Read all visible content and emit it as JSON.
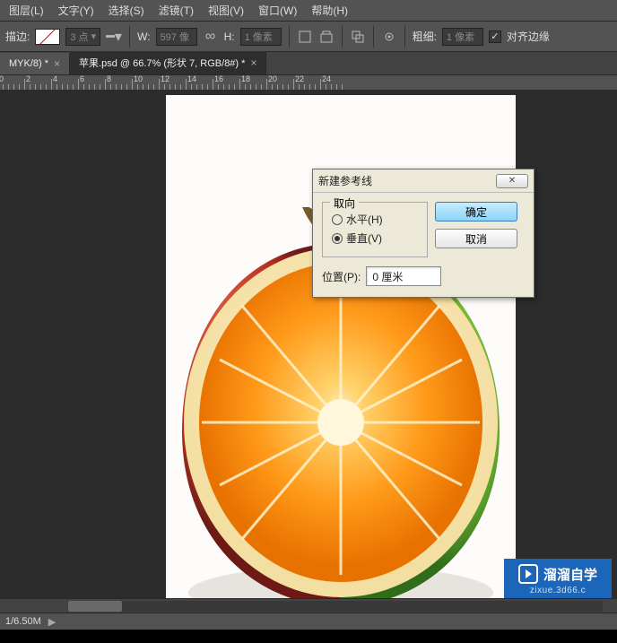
{
  "menu": {
    "items": [
      "图层(L)",
      "文字(Y)",
      "选择(S)",
      "滤镜(T)",
      "视图(V)",
      "窗口(W)",
      "帮助(H)"
    ]
  },
  "options": {
    "stroke_label": "描边:",
    "pt_value": "3 点",
    "w_label": "W:",
    "w_value": "597 像",
    "link_icon": "∞",
    "h_label": "H:",
    "h_value": "1 像素",
    "thickness_label": "粗细:",
    "thickness_value": "1 像素",
    "align_label": "对齐边缘"
  },
  "tabs": [
    {
      "label": "MYK/8) *",
      "active": false
    },
    {
      "label": "苹果.psd @ 66.7% (形状 7, RGB/8#) *",
      "active": true
    }
  ],
  "ruler_labels": [
    "0",
    "2",
    "4",
    "6",
    "8",
    "10",
    "12",
    "14",
    "16",
    "18",
    "20",
    "22",
    "24"
  ],
  "dialog": {
    "title": "新建参考线",
    "orientation_legend": "取向",
    "radio_h": "水平(H)",
    "radio_v": "垂直(V)",
    "position_label": "位置(P):",
    "position_value": "0 厘米",
    "ok": "确定",
    "cancel": "取消"
  },
  "watermark": {
    "main": "溜溜自学",
    "sub": "zixue.3d66.c"
  },
  "status": {
    "text1": "1/6.50M"
  }
}
